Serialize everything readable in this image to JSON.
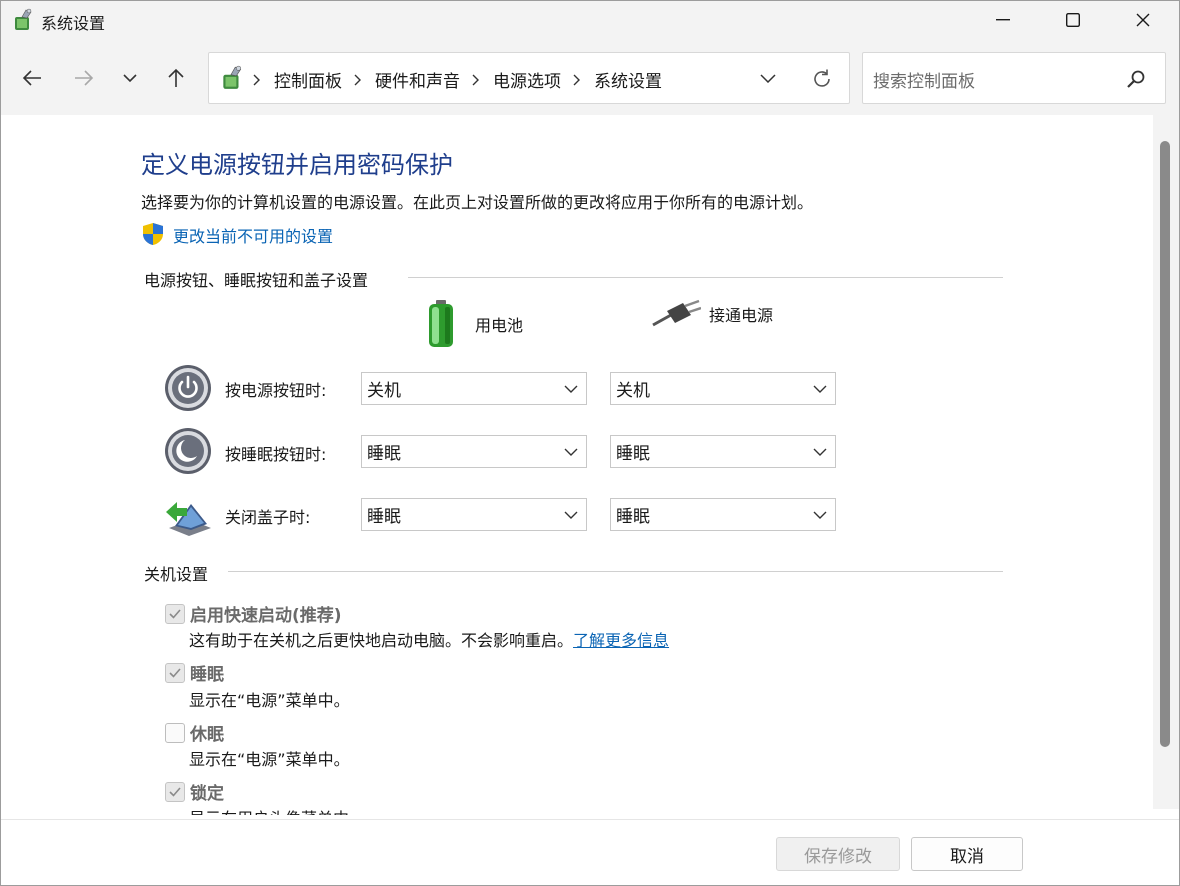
{
  "window": {
    "title": "系统设置"
  },
  "nav": {
    "breadcrumbs": [
      "控制面板",
      "硬件和声音",
      "电源选项",
      "系统设置"
    ],
    "search_placeholder": "搜索控制面板"
  },
  "page": {
    "title": "定义电源按钮并启用密码保护",
    "description": "选择要为你的计算机设置的电源设置。在此页上对设置所做的更改将应用于你所有的电源计划。",
    "change_link": "更改当前不可用的设置"
  },
  "buttons_section": {
    "heading": "电源按钮、睡眠按钮和盖子设置",
    "col_battery": "用电池",
    "col_plugged": "接通电源",
    "rows": [
      {
        "label": "按电源按钮时:",
        "battery": "关机",
        "plugged": "关机"
      },
      {
        "label": "按睡眠按钮时:",
        "battery": "睡眠",
        "plugged": "睡眠"
      },
      {
        "label": "关闭盖子时:",
        "battery": "睡眠",
        "plugged": "睡眠"
      }
    ]
  },
  "shutdown_section": {
    "heading": "关机设置",
    "items": [
      {
        "label": "启用快速启动(推荐)",
        "checked": true,
        "desc": "这有助于在关机之后更快地启动电脑。不会影响重启。",
        "link": "了解更多信息"
      },
      {
        "label": "睡眠",
        "checked": true,
        "desc": "显示在“电源”菜单中。"
      },
      {
        "label": "休眠",
        "checked": false,
        "desc": "显示在“电源”菜单中。"
      },
      {
        "label": "锁定",
        "checked": true,
        "desc": "显示在用户头像菜单中。"
      }
    ]
  },
  "footer": {
    "save_label": "保存修改",
    "cancel_label": "取消"
  },
  "colors": {
    "title_blue": "#1f3e8c",
    "link_blue": "#0a64b4"
  }
}
